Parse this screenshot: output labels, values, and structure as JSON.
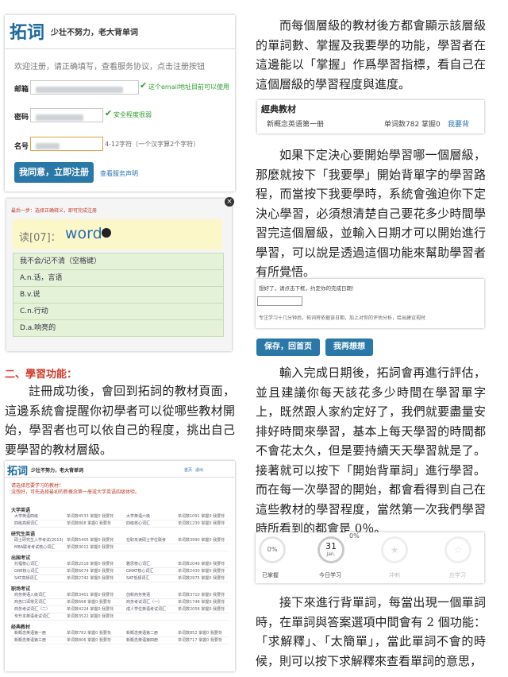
{
  "register": {
    "logo": "拓词",
    "slogan": "少壮不努力，老大背单词",
    "welcome": "欢迎注册，请正确填写，查看服务协议，点击注册按钮",
    "email_label": "邮箱",
    "email_ok": "这个email地址目前可以使用",
    "password_label": "密码",
    "password_ok": "安全程度很弱",
    "name_label": "名号",
    "name_hint": "4-12字符（一个汉字算2个字符）",
    "submit": "我同意，立即注册",
    "terms": "查看服务声明"
  },
  "quiz": {
    "hint": "最后一步：选择正确释义，即可完成注册",
    "prompt": "读[07]：",
    "word": "word",
    "options": [
      "我不会/记不清（空格键）",
      "A.n.话，言语",
      "B.v.说",
      "C.n.行动",
      "D.a.响亮的"
    ]
  },
  "section2": {
    "heading": "二、學習功能：",
    "paragraph": "註冊成功後，會回到拓詞的教材頁面，這邊系統會提醒你初學者可以從哪些教材開始，學習者也可以依自己的程度，挑出自己要學習的教材層級。"
  },
  "book": {
    "logo": "拓词",
    "slogan": "少壮不努力，老大背单词",
    "nav": [
      "首页",
      "退出"
    ],
    "notice1": "请选择您要学习的教材！",
    "notice2": "没想好，可先选择最初的新概念第一册或大学英语四级体验。",
    "groups": [
      {
        "title": "大学英语",
        "rows": [
          [
            "大学英语四级",
            "单词数4533 掌握0 我要背",
            "大学英语六级",
            "单词数1091 掌握0 我要背"
          ],
          [
            "四级高频词汇",
            "单词数868 掌握0 我要背",
            "四级核心词汇",
            "单词数1230 掌握0 我要背"
          ]
        ]
      },
      {
        "title": "研究生英语",
        "rows": [
          [
            "硕士研究生入学考试(2013)",
            "单词数5405 掌握0 我要背",
            "在职攻读硕士学位联考",
            "单词数3990 掌握0 我要背"
          ],
          [
            "MBA联考考试核心词汇",
            "单词数3012 掌握0 我要背",
            "",
            ""
          ]
        ]
      },
      {
        "title": "出国考试",
        "rows": [
          [
            "托福核心词汇",
            "单词数2518 掌握0 我要背",
            "雅思核心词汇",
            "单词数2049 掌握0 我要背"
          ],
          [
            "GRE核心词汇",
            "单词数6674 掌握0 我要背",
            "GMAT核心词汇",
            "单词数2430 掌握0 我要背"
          ],
          [
            "SAT高频词汇",
            "单词数2742 掌握0 我要背",
            "SAT低频词汇",
            "单词数2975 掌握0 我要背"
          ]
        ]
      },
      {
        "title": "职场考试",
        "rows": [
          [
            "商务英语入级词汇",
            "单词数3401 掌握0 我要背",
            "创新商务英语",
            "单词数3710 掌握0 我要背"
          ],
          [
            "商务口译常见词汇",
            "单词数668 掌握0 我要背",
            "商务考试词汇（一）",
            "单词数1748 掌握0 我要背"
          ],
          [
            "商务考试词汇（二）",
            "单词数4224 掌握0 我要背",
            "成人学位英语考试词汇",
            "单词数2058 掌握0 我要背"
          ],
          [
            "专升本英语考试词汇",
            "单词数3522 掌握0 我要背",
            "",
            ""
          ]
        ]
      },
      {
        "title": "经典教材",
        "rows": [
          [
            "新概念英语第一册",
            "单词数782 掌握0 我要背",
            "新概念英语第二册",
            "单词数852 掌握0 我要背"
          ],
          [
            "新概念英语第三册",
            "单词数806 掌握0 我要背",
            "新概念英语第四册",
            "单词数717 掌握0 我要背"
          ]
        ]
      }
    ]
  },
  "right": {
    "para1": "而每個層級的教材後方都會顯示該層級的單詞數、掌握及我要學的功能，學習者在這邊能以「掌握」作爲學習指標，看自己在這個層級的學習程度與進度。",
    "classic": {
      "title": "經典教材",
      "item": "新概念英语第一册",
      "stats": "单词数782 掌握0",
      "action": "我要背"
    },
    "para2": "如果下定決心要開始學習哪一個層級，那麼就按下「我要學」開始背單字的學習路程，而當按下我要學時，系統會強迫你下定決心學習，必須想清楚自己要花多少時間學習完這個層級，並輸入日期才可以開始進行學習，可以說是透過這個功能來幫助學習者有所覺悟。",
    "date_prompt": "想好了，请点击下框，约定你的完成日期！",
    "date_note": "专注学习十几分钟后，拓词将依据该日期，加上对你的评估分析，给出建议视时",
    "btn_save": "保存，回首页",
    "btn_think": "我再想想",
    "para3": "輸入完成日期後，拓詞會再進行評估，並且建議你每天該花多少時間在學習單字上，既然跟人家約定好了，我們就要盡量安排好時間來學習，基本上每天學習的時間都不會花太久，但是要持續天天學習就是了。接著就可以按下「開始背單詞」進行學習。而在每一次學習的開始，都會看得到自己在這些教材的學習程度，當然第一次我們學習時所看到的都會是 0％。",
    "progress": {
      "pct_top": "0%",
      "pct_ring": "0%",
      "day": "31",
      "month": "Jan.",
      "labels": [
        "已掌握",
        "今日学习",
        "冲刺",
        "应学习"
      ]
    },
    "para4": "接下來進行背單詞，每當出現一個單詞時，在單詞與答案選項中間會有 2 個功能：「求解釋」、「太簡單」，當此單詞不會的時候，則可以按下求解釋來查看單詞的意思，"
  },
  "colors": {
    "accent": "#2a78a8",
    "brand": "#1c6aa0",
    "ok": "#2f9a2f",
    "heading": "#d43a2a"
  }
}
